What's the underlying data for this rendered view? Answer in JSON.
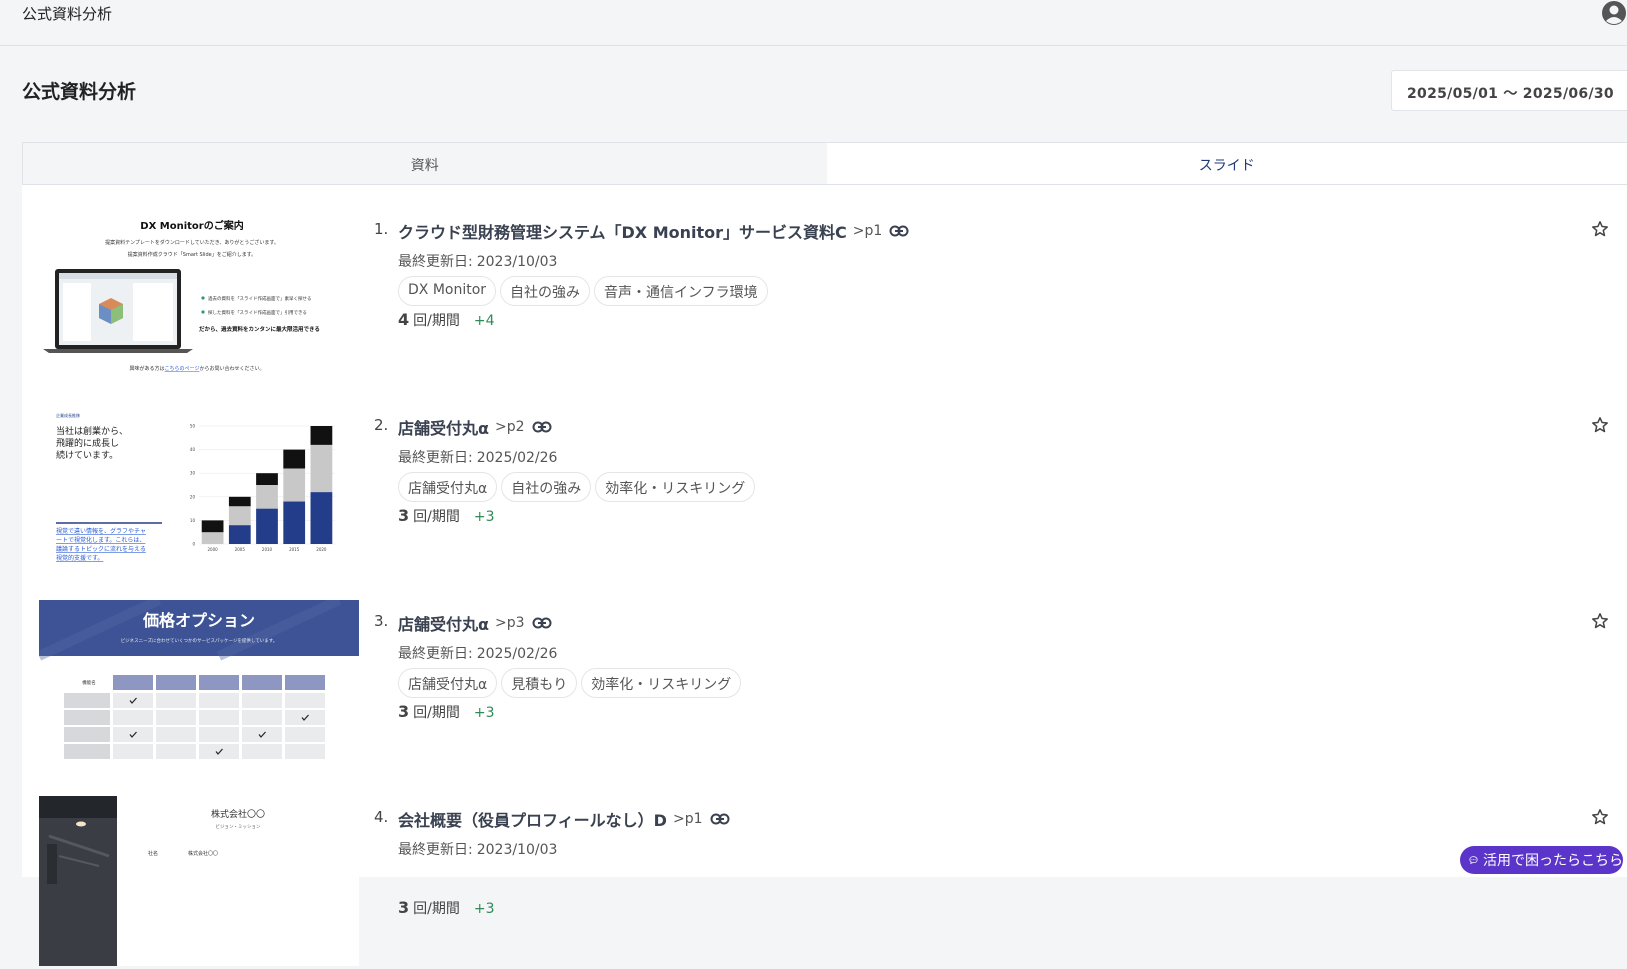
{
  "app": {
    "title": "公式資料分析"
  },
  "page": {
    "title": "公式資料分析",
    "date_range": "2025/05/01 ～ 2025/06/30"
  },
  "tabs": [
    {
      "label": "資料",
      "active": false
    },
    {
      "label": "スライド",
      "active": true
    }
  ],
  "labels": {
    "updated_prefix": "最終更新日:",
    "count_unit": "回/期間"
  },
  "items": [
    {
      "rank": "1.",
      "title": "クラウド型財務管理システム「DX Monitor」サービス資料C",
      "page_ref": ">p1",
      "updated": "2023/10/03",
      "tags": [
        "DX Monitor",
        "自社の強み",
        "音声・通信インフラ環境"
      ],
      "count": "4",
      "delta": "+4",
      "thumb": {
        "heading": "DX Monitorのご案内",
        "line1": "提案資料テンプレートをダウンロードしていただき、ありがとうございます。",
        "line2": "提案資料作成クラウド「Smart Slide」をご紹介します。",
        "bullet1": "過去の資料を「スライド作成画面で」素早く探せる",
        "bullet2": "探した資料を「スライド作成画面で」引用できる",
        "emphasis": "だから、過去資料をカンタンに最大限活用できる",
        "footer_pre": "興味がある方は",
        "footer_link": "こちらのページ",
        "footer_post": "からお問い合わせください。"
      }
    },
    {
      "rank": "2.",
      "title": "店舗受付丸α",
      "page_ref": ">p2",
      "updated": "2025/02/26",
      "tags": [
        "店舗受付丸α",
        "自社の強み",
        "効率化・リスキリング"
      ],
      "count": "3",
      "delta": "+3",
      "thumb": {
        "label": "企業成長推移",
        "heading_lines": [
          "当社は創業から、",
          "飛躍的に成長し",
          "続けています。"
        ],
        "note_lines": [
          "視覚で違い情報を、グラフやチャ",
          "ートで視覚化します。これらは、",
          "議論するトピックに流れを与える",
          "視覚的支援です。"
        ],
        "chart_data": {
          "type": "bar",
          "categories": [
            "2000",
            "2005",
            "2010",
            "2015",
            "2020"
          ],
          "ylim": [
            0,
            50
          ],
          "yticks": [
            "0",
            "10",
            "20",
            "30",
            "40",
            "50"
          ],
          "series": [
            {
              "values": [
                0,
                8,
                15,
                18,
                22
              ],
              "color": "#233d8a"
            },
            {
              "values": [
                5,
                8,
                10,
                14,
                20
              ],
              "color": "#c8c8c8"
            },
            {
              "values": [
                5,
                4,
                5,
                8,
                8
              ],
              "color": "#111111"
            }
          ]
        }
      }
    },
    {
      "rank": "3.",
      "title": "店舗受付丸α",
      "page_ref": ">p3",
      "updated": "2025/02/26",
      "tags": [
        "店舗受付丸α",
        "見積もり",
        "効率化・リスキリング"
      ],
      "count": "3",
      "delta": "+3",
      "thumb": {
        "heading": "価格オプション",
        "subheading": "ビジネスニーズに合わせていくつかのサービスパッケージを提供しています。",
        "corner_label": "機能名",
        "checks": [
          [
            1,
            0
          ],
          [
            2,
            4
          ],
          [
            3,
            0
          ],
          [
            3,
            3
          ],
          [
            4,
            2
          ]
        ]
      }
    },
    {
      "rank": "4.",
      "title": "会社概要（役員プロフィールなし）D",
      "page_ref": ">p1",
      "updated": "2023/10/03",
      "tags": [],
      "count": "3",
      "delta": "+3",
      "thumb": {
        "company": "株式会社〇〇",
        "subtitle": "ビジョン・ミッション",
        "field_label": "社名",
        "field_value": "株式会社〇〇"
      }
    }
  ],
  "help": {
    "label": "活用で困ったらこちら"
  },
  "colors": {
    "accent": "#1f3a78",
    "help": "#5b35c9",
    "delta": "#2e8b57"
  }
}
